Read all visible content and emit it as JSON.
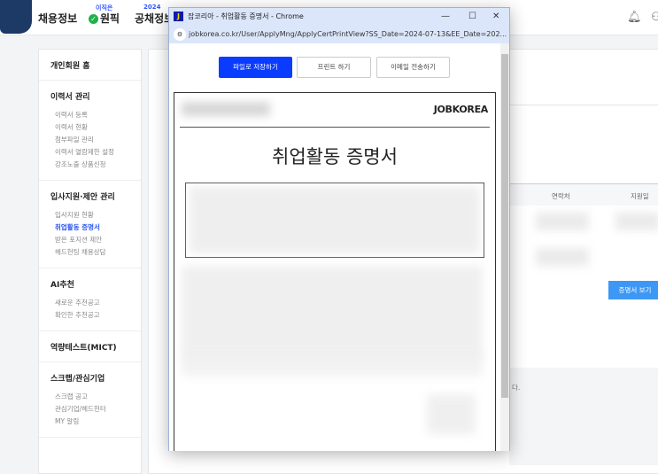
{
  "header": {
    "nav": [
      {
        "label": "채용정보"
      },
      {
        "label": "원픽",
        "sup": "이직은"
      },
      {
        "label": "공채정보",
        "sup": "2024"
      }
    ]
  },
  "sidebar": {
    "home": "개인회원 홈",
    "sections": [
      {
        "title": "이력서 관리",
        "items": [
          "이력서 등록",
          "이력서 현황",
          "첨부파일 관리",
          "이력서 열람제한 설정",
          "강조노출 상품신청"
        ]
      },
      {
        "title": "입사지원·제안 관리",
        "items": [
          "입사지원 현황",
          "취업활동 증명서",
          "받은 포지션 제안",
          "헤드헌팅 채용상담"
        ]
      },
      {
        "title": "AI추천",
        "items": [
          "새로운 추천공고",
          "확인한 추천공고"
        ]
      },
      {
        "title": "역량테스트(MICT)",
        "items": []
      },
      {
        "title": "스크랩/관심기업",
        "items": [
          "스크랩 공고",
          "관심기업/헤드헌터",
          "MY 알림"
        ]
      }
    ]
  },
  "main": {
    "col_contact": "연락처",
    "col_date": "지원일",
    "cert_button": "증명서 보기",
    "foot_text": "다."
  },
  "popup": {
    "title": "잡코리아 - 취업활동 증명서 - Chrome",
    "url": "jobkorea.co.kr/User/ApplyMng/ApplyCertPrintView?SS_Date=2024-07-13&EE_Date=202...",
    "buttons": {
      "save": "파일로 저장하기",
      "print": "프린트 하기",
      "email": "이메일 전송하기"
    },
    "doc": {
      "brand": "JOBKOREA",
      "title": "취업활동 증명서"
    }
  }
}
